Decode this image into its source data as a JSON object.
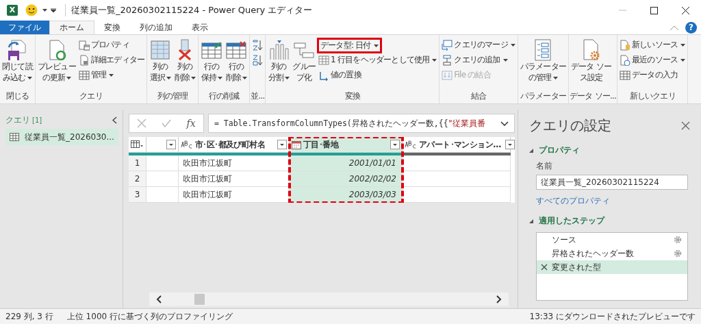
{
  "title_bar": {
    "app_badge": "X",
    "title": "従業員一覧_20260302115224 - Power Query エディター"
  },
  "tabs": [
    {
      "label": "ファイル",
      "kind": "file",
      "selected": false
    },
    {
      "label": "ホーム",
      "kind": "tab",
      "selected": true
    },
    {
      "label": "変換",
      "kind": "tab",
      "selected": false
    },
    {
      "label": "列の追加",
      "kind": "tab",
      "selected": false
    },
    {
      "label": "表示",
      "kind": "tab",
      "selected": false
    }
  ],
  "help": "?",
  "ribbon": {
    "groups": [
      {
        "label": "閉じる",
        "items": [
          {
            "kind": "large",
            "lines": [
              "閉じて読",
              "み込む"
            ],
            "dropdown": true
          }
        ]
      },
      {
        "label": "クエリ",
        "items": [
          {
            "kind": "large",
            "lines": [
              "プレビュー",
              "の更新"
            ],
            "dropdown": true
          },
          {
            "kind": "small",
            "label": "プロパティ",
            "dropdown": false
          },
          {
            "kind": "small",
            "label": "詳細エディター",
            "dropdown": false
          },
          {
            "kind": "small",
            "label": "管理",
            "dropdown": true
          }
        ]
      },
      {
        "label": "列の管理",
        "items": [
          {
            "kind": "large",
            "lines": [
              "列の",
              "選択"
            ],
            "dropdown": true
          },
          {
            "kind": "large",
            "lines": [
              "列の",
              "削除"
            ],
            "dropdown": true
          }
        ]
      },
      {
        "label": "行の削減",
        "items": [
          {
            "kind": "large",
            "lines": [
              "行の",
              "保持"
            ],
            "dropdown": true
          },
          {
            "kind": "large",
            "lines": [
              "行の",
              "削除"
            ],
            "dropdown": true
          }
        ]
      },
      {
        "label": "並...",
        "items": [
          {
            "kind": "icon",
            "dropdown": false
          },
          {
            "kind": "icon",
            "dropdown": false
          }
        ]
      },
      {
        "label": "変換",
        "items": [
          {
            "kind": "large",
            "lines": [
              "列の",
              "分割"
            ],
            "dropdown": true
          },
          {
            "kind": "large",
            "lines": [
              "グルー",
              "プ化"
            ],
            "dropdown": false
          },
          {
            "kind": "small",
            "label": "データ型: 日付",
            "dropdown": true,
            "highlighted": true
          },
          {
            "kind": "small",
            "label": "1 行目をヘッダーとして使用",
            "dropdown": true
          },
          {
            "kind": "small",
            "label": "値の置換",
            "dropdown": false
          }
        ]
      },
      {
        "label": "結合",
        "items": [
          {
            "kind": "small",
            "label": "クエリのマージ",
            "dropdown": true
          },
          {
            "kind": "small",
            "label": "クエリの追加",
            "dropdown": true
          },
          {
            "kind": "small",
            "label": "File の結合",
            "dropdown": false,
            "disabled": true
          }
        ]
      },
      {
        "label": "パラメーター",
        "items": [
          {
            "kind": "large",
            "lines": [
              "パラメーター",
              "の管理"
            ],
            "dropdown": true
          }
        ]
      },
      {
        "label": "データ ソー...",
        "items": [
          {
            "kind": "large",
            "lines": [
              "データ ソー",
              "ス設定"
            ],
            "dropdown": false
          }
        ]
      },
      {
        "label": "新しいクエリ",
        "items": [
          {
            "kind": "small",
            "label": "新しいソース",
            "dropdown": true
          },
          {
            "kind": "small",
            "label": "最近のソース",
            "dropdown": true
          },
          {
            "kind": "small",
            "label": "データの入力",
            "dropdown": false
          }
        ]
      }
    ]
  },
  "queries_pane": {
    "title": "クエリ",
    "count": "[1]",
    "items": [
      {
        "label": "従業員一覧_2026030...",
        "selected": true
      }
    ]
  },
  "formula_bar": {
    "fx": "fx",
    "code": "= Table.TransformColumnTypes(昇格されたヘッダー数,{{",
    "string": "\"従業員番"
  },
  "table": {
    "columns": [
      {
        "kind": "none",
        "quality_known": true,
        "selected": false,
        "highlighted": false
      },
      {
        "kind": "text",
        "name": "市･区･都及び町村名",
        "quality_known": true,
        "selected": false,
        "highlighted": false
      },
      {
        "kind": "date",
        "name": "丁目･番地",
        "quality_known": true,
        "selected": true,
        "highlighted": true
      },
      {
        "kind": "text",
        "name": "アパート･マンション...",
        "quality_known": false,
        "selected": false,
        "highlighted": false
      }
    ],
    "rows": [
      {
        "number": "1",
        "cells": [
          null,
          "吹田市江坂町",
          "2001/01/01",
          null
        ]
      },
      {
        "number": "2",
        "cells": [
          null,
          "吹田市江坂町",
          "2002/02/02",
          null
        ]
      },
      {
        "number": "3",
        "cells": [
          null,
          "吹田市江坂町",
          "2003/03/03",
          null
        ]
      }
    ]
  },
  "settings": {
    "title": "クエリの設定",
    "properties_heading": "プロパティ",
    "name_label": "名前",
    "name_value": "従業員一覧_20260302115224",
    "all_properties_link": "すべてのプロパティ",
    "steps_heading": "適用したステップ",
    "steps": [
      {
        "label": "ソース",
        "has_settings": true,
        "selected": false
      },
      {
        "label": "昇格されたヘッダー数",
        "has_settings": true,
        "selected": false
      },
      {
        "label": "変更された型",
        "has_settings": false,
        "selected": true
      }
    ]
  },
  "status_bar": {
    "columns_rows": "229 列, 3 行",
    "profiling": "上位 1000 行に基づく列のプロファイリング",
    "preview": "13:33 にダウンロードされたプレビューです"
  }
}
